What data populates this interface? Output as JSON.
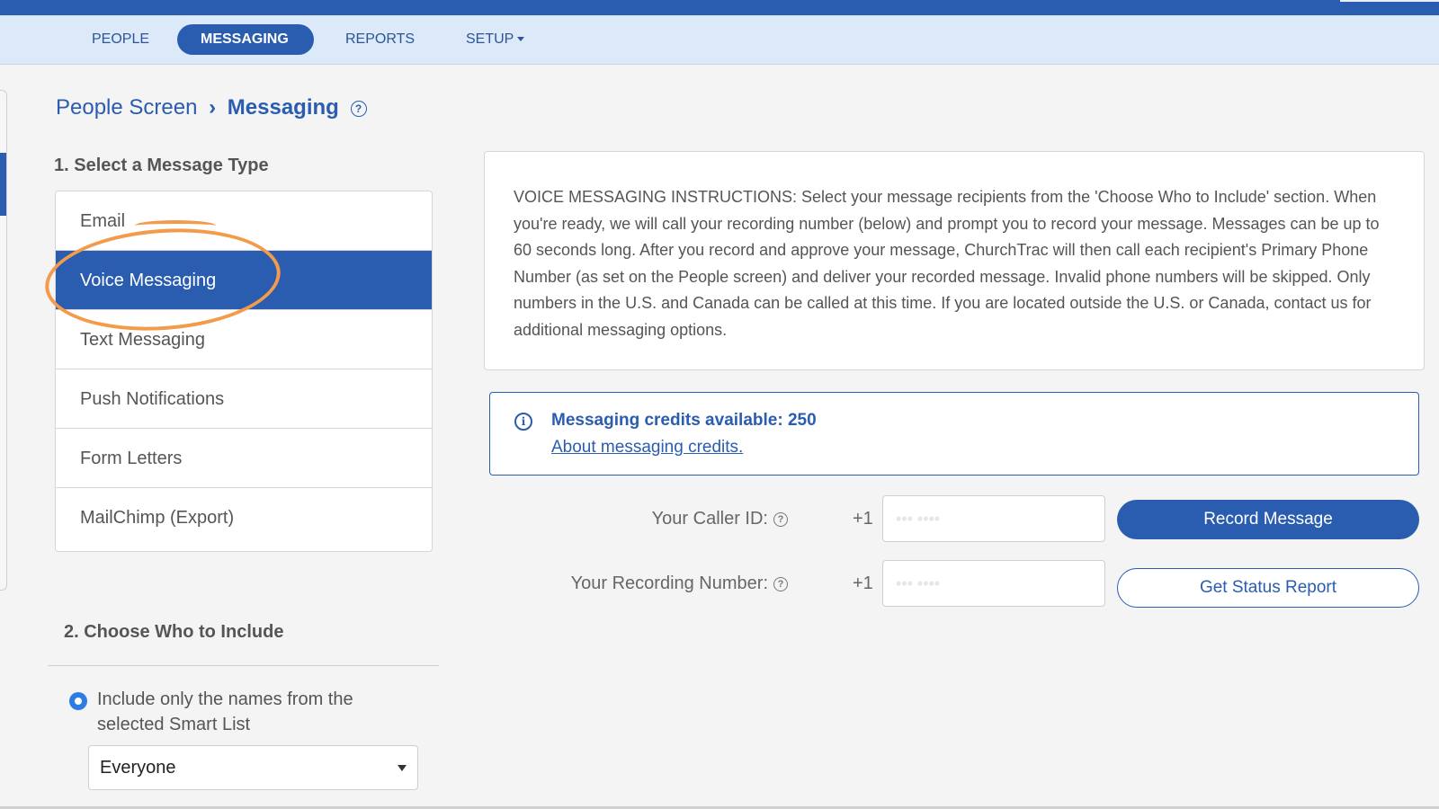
{
  "nav": {
    "items": [
      {
        "label": "PEOPLE",
        "active": false
      },
      {
        "label": "MESSAGING",
        "active": true
      },
      {
        "label": "REPORTS",
        "active": false
      },
      {
        "label": "SETUP",
        "active": false,
        "has_dropdown": true
      }
    ]
  },
  "breadcrumb": {
    "parent": "People Screen",
    "current": "Messaging",
    "help": "?"
  },
  "step1": {
    "title": "1. Select a Message Type",
    "items": [
      {
        "label": "Email",
        "active": false
      },
      {
        "label": "Voice Messaging",
        "active": true
      },
      {
        "label": "Text Messaging",
        "active": false
      },
      {
        "label": "Push Notifications",
        "active": false
      },
      {
        "label": "Form Letters",
        "active": false
      },
      {
        "label": "MailChimp (Export)",
        "active": false
      }
    ]
  },
  "instructions": {
    "text": "VOICE MESSAGING INSTRUCTIONS: Select your message recipients from the 'Choose Who to Include' section. When you're ready, we will call your recording number (below) and prompt you to record your message. Messages can be up to 60 seconds long. After you record and approve your message, ChurchTrac will then call each recipient's Primary Phone Number (as set on the People screen) and deliver your recorded message. Invalid phone numbers will be skipped. Only numbers in the U.S. and Canada can be called at this time. If you are located outside the U.S. or Canada, contact us for additional messaging options."
  },
  "credits": {
    "icon": "info-icon",
    "text": "Messaging credits available: 250",
    "link": "About messaging credits."
  },
  "caller_id": {
    "label": "Your Caller ID:",
    "prefix": "+1",
    "value": "••• ••••"
  },
  "recording_number": {
    "label": "Your Recording Number:",
    "prefix": "+1",
    "value": "••• ••••"
  },
  "buttons": {
    "record": "Record Message",
    "status": "Get Status Report"
  },
  "step2": {
    "title": "2. Choose Who to Include",
    "radio_label": "Include only the names from the selected Smart List",
    "selected_list": "Everyone"
  },
  "colors": {
    "brand_blue": "#2a5db0",
    "nav_bg": "#dbe9f8",
    "annotation": "#f39a4b"
  }
}
